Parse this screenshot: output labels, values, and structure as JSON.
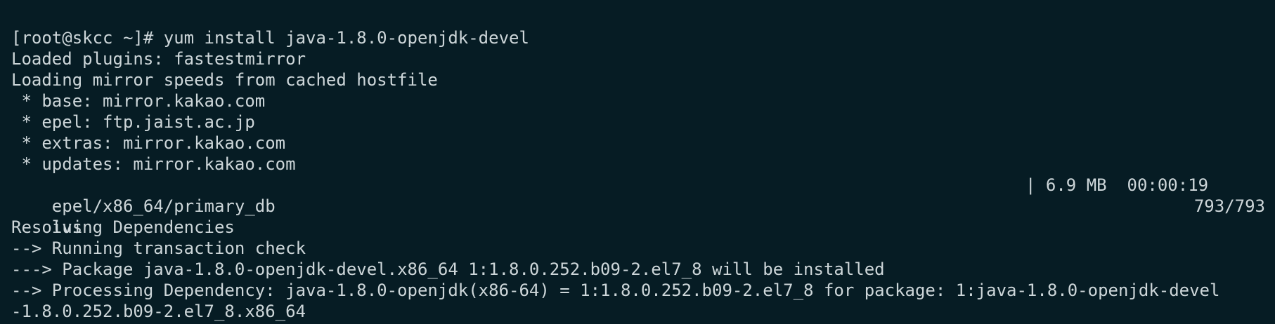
{
  "terminal": {
    "lines": [
      "[root@skcc ~]# yum install java-1.8.0-openjdk-devel",
      "Loaded plugins: fastestmirror",
      "Loading mirror speeds from cached hostfile",
      " * base: mirror.kakao.com",
      " * epel: ftp.jaist.ac.jp",
      " * extras: mirror.kakao.com",
      " * updates: mirror.kakao.com",
      "epel/x86_64/primary_db",
      "ius",
      "Resolving Dependencies",
      "--> Running transaction check",
      "---> Package java-1.8.0-openjdk-devel.x86_64 1:1.8.0.252.b09-2.el7_8 will be installed",
      "--> Processing Dependency: java-1.8.0-openjdk(x86-64) = 1:1.8.0.252.b09-2.el7_8 for package: 1:java-1.8.0-openjdk-devel",
      "-1.8.0.252.b09-2.el7_8.x86_64"
    ],
    "epel_progress": "| 6.9 MB  00:00:19",
    "ius_progress": "793/793"
  }
}
